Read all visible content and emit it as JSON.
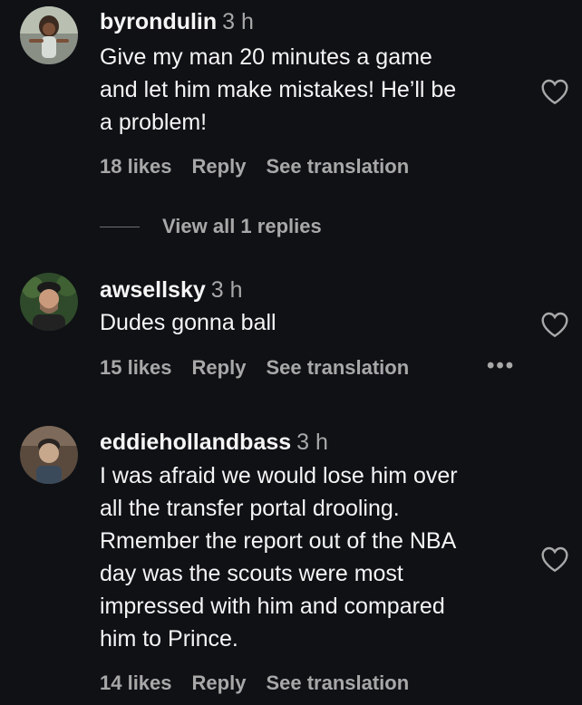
{
  "comments": [
    {
      "username": "byrondulin",
      "time": "3 h",
      "lines": [
        "Give my man 20 minutes a game",
        "and let him make mistakes! He’ll be",
        "a problem!"
      ],
      "likes": "18 likes",
      "reply": "Reply",
      "translate": "See translation"
    },
    {
      "username": "awsellsky",
      "time": "3 h",
      "lines": [
        "Dudes gonna ball"
      ],
      "likes": "15 likes",
      "reply": "Reply",
      "translate": "See translation",
      "more": "•••"
    },
    {
      "username": "eddiehollandbass",
      "time": "3 h",
      "lines": [
        "I was afraid we would lose him over",
        "all the transfer portal drooling.",
        "Rmember the report out of the NBA",
        "day was the scouts were most",
        "impressed with him and compared",
        "him to Prince."
      ],
      "likes": "14 likes",
      "reply": "Reply",
      "translate": "See translation"
    }
  ],
  "view_replies": "View all 1 replies",
  "icons": {
    "like": "heart-outline-icon",
    "more": "more-horizontal-icon"
  },
  "colors": {
    "background": "#0f1115",
    "text": "#f5f5f5",
    "secondary": "#a8a8a8"
  }
}
